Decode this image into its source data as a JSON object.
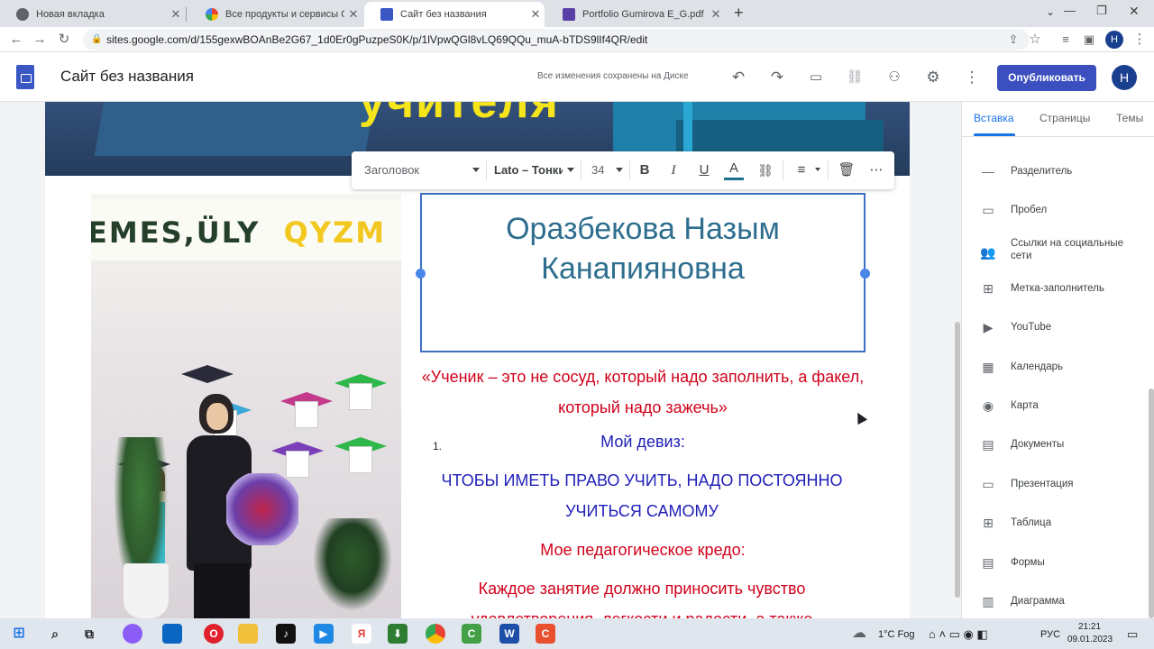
{
  "browser": {
    "tabs": [
      {
        "label": "Новая вкладка",
        "icon": "chrome-icon"
      },
      {
        "label": "Все продукты и сервисы Google",
        "icon": "google-icon"
      },
      {
        "label": "Сайт без названия",
        "icon": "sites-icon"
      },
      {
        "label": "Portfolio Gumirova E_G.pdf",
        "icon": "pdf-icon"
      }
    ],
    "new_tab": "+",
    "url": "sites.google.com/d/155gexwBOAnBe2G67_1d0Er0gPuzpeS0K/p/1lVpwQGl8vLQ69QQu_muA-bTDS9lIf4QR/edit",
    "profile_initial": "H"
  },
  "app": {
    "title": "Сайт без названия",
    "saved_status": "Все изменения сохранены на Диске",
    "publish_label": "Опубликовать",
    "avatar_initial": "H"
  },
  "page": {
    "banner_text": "учителя",
    "photo_sign_left": "EMES,ÜLY",
    "photo_sign_right": "QYZM",
    "heading": "Оразбекова Назым Канапияновна",
    "quote": "«Ученик – это не сосуд, который надо заполнить, а факел, который надо зажечь»",
    "list_number": "1.",
    "motto_title": "Мой девиз:",
    "motto_text": "ЧТОБЫ ИМЕТЬ ПРАВО УЧИТЬ, НАДО ПОСТОЯННО УЧИТЬСЯ САМОМУ",
    "credo_title": "Мое педагогическое кредо:",
    "credo_text": "Каждое занятие должно приносить чувство удовлетворения, легкости и радости, а также"
  },
  "format_toolbar": {
    "style": "Заголовок",
    "font": "Lato – Тонкий",
    "size": "34"
  },
  "side_panel": {
    "tabs": [
      "Вставка",
      "Страницы",
      "Темы"
    ],
    "items": [
      {
        "label": "Разделитель",
        "icon": "divider-icon"
      },
      {
        "label": "Пробел",
        "icon": "spacer-icon"
      },
      {
        "label": "Ссылки на социальные сети",
        "icon": "social-links-icon"
      },
      {
        "label": "Метка-заполнитель",
        "icon": "placeholder-icon"
      },
      {
        "label": "YouTube",
        "icon": "youtube-icon"
      },
      {
        "label": "Календарь",
        "icon": "calendar-icon"
      },
      {
        "label": "Карта",
        "icon": "map-pin-icon"
      },
      {
        "label": "Документы",
        "icon": "docs-icon"
      },
      {
        "label": "Презентация",
        "icon": "slides-icon"
      },
      {
        "label": "Таблица",
        "icon": "sheets-icon"
      },
      {
        "label": "Формы",
        "icon": "forms-icon"
      },
      {
        "label": "Диаграмма",
        "icon": "chart-icon"
      }
    ]
  },
  "taskbar": {
    "weather": "1°C Fog",
    "language": "РУС",
    "time": "21:21",
    "date": "09.01.2023"
  }
}
